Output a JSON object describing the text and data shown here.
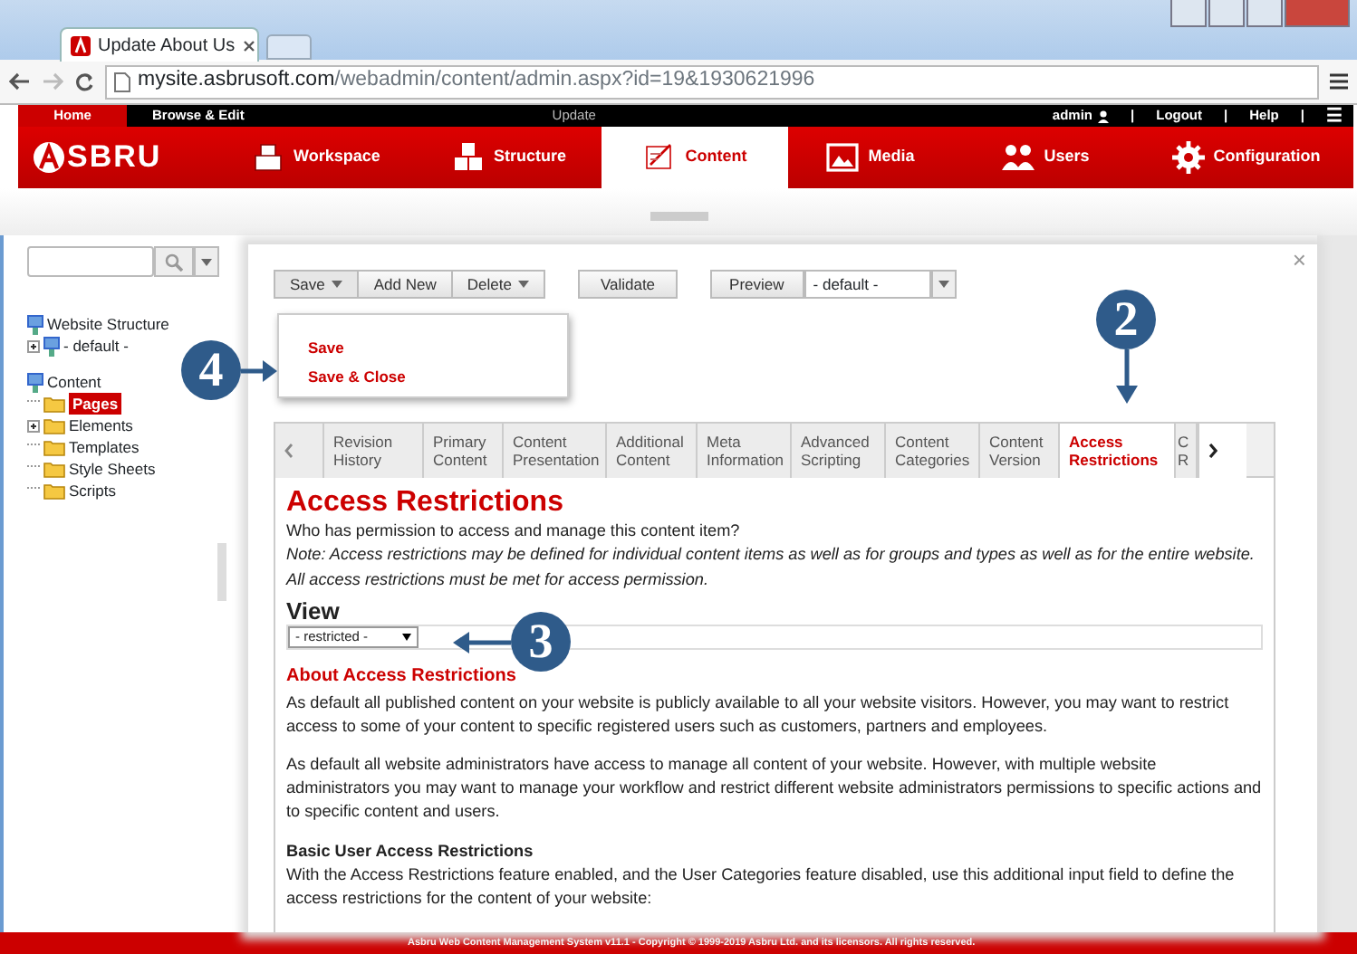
{
  "browser": {
    "tab_title": "Update About Us",
    "url_host": "mysite.asbrusoft.com",
    "url_path": "/webadmin/content/admin.aspx?id=19&1930621996"
  },
  "topbar": {
    "left": [
      {
        "label": "Home",
        "selected": true
      },
      {
        "label": "Browse & Edit",
        "selected": false
      }
    ],
    "center": "Update",
    "right": [
      "admin",
      "|",
      "Logout",
      "|",
      "Help",
      "|"
    ],
    "menu_glyph": "☰"
  },
  "nav": {
    "logo": "SBRU",
    "items": [
      {
        "label": "Workspace",
        "selected": false
      },
      {
        "label": "Structure",
        "selected": false
      },
      {
        "label": "Content",
        "selected": true
      },
      {
        "label": "Media",
        "selected": false
      },
      {
        "label": "Users",
        "selected": false
      },
      {
        "label": "Configuration",
        "selected": false
      }
    ]
  },
  "sidebar": {
    "tree": [
      {
        "label": "Website Structure",
        "selected": false,
        "children": [
          {
            "label": "- default -",
            "expanded": false,
            "selected": false
          }
        ]
      },
      {
        "label": "Content",
        "selected": false,
        "children": [
          {
            "label": "Pages",
            "selected": true
          },
          {
            "label": "Elements",
            "expanded": false,
            "selected": false
          },
          {
            "label": "Templates",
            "selected": false
          },
          {
            "label": "Style Sheets",
            "selected": false
          },
          {
            "label": "Scripts",
            "selected": false
          }
        ]
      }
    ]
  },
  "toolbar": {
    "group": [
      {
        "label": "Save",
        "dropdown": true,
        "expanded": true
      },
      {
        "label": "Add New",
        "dropdown": false,
        "expanded": false
      },
      {
        "label": "Delete",
        "dropdown": true,
        "expanded": false
      }
    ],
    "validate": "Validate",
    "preview": "Preview",
    "preview_select": "- default -"
  },
  "dialog_close": "×",
  "menu": {
    "items": [
      "Save",
      "Save & Close"
    ]
  },
  "callouts": [
    {
      "number": "4"
    },
    {
      "number": "2"
    },
    {
      "number": "3"
    }
  ],
  "tabs": [
    {
      "label": "Revision History",
      "selected": false
    },
    {
      "label": "Primary Content",
      "selected": false
    },
    {
      "label": "Content Presentation",
      "selected": false
    },
    {
      "label": "Additional Content",
      "selected": false
    },
    {
      "label": "Meta Information",
      "selected": false
    },
    {
      "label": "Advanced Scripting",
      "selected": false
    },
    {
      "label": "Content Categories",
      "selected": false
    },
    {
      "label": "Content Version",
      "selected": false
    },
    {
      "label": "Access Restrictions",
      "selected": true
    },
    {
      "label": "C R",
      "selected": false
    }
  ],
  "content": {
    "title": "Access Restrictions",
    "question": "Who has permission to access and manage this content item?",
    "note": "Note: Access restrictions may be defined for individual content items as well as for groups and types as well as for the entire website. All access restrictions must be met for access permission.",
    "view_label": "View",
    "view_select": "- restricted -",
    "about_title": "About Access Restrictions",
    "paragraphs": [
      "As default all published content on your website is publicly available to all your website visitors. However, you may want to restrict access to some of your content to specific registered users such as customers, partners and employees.",
      "As default all website administrators have access to manage all content of your website. However, with multiple website administrators you may want to manage your workflow and restrict different website administrators permissions to specific actions and to specific content and users."
    ],
    "basic_title": "Basic User Access Restrictions",
    "basic_text": "With the Access Restrictions feature enabled, and the User Categories feature disabled, use this additional input field to define the access restrictions for the content of your website:"
  },
  "footer": "Asbru Web Content Management System v11.1 - Copyright © 1999-2019 Asbru Ltd. and its licensors. All rights reserved."
}
